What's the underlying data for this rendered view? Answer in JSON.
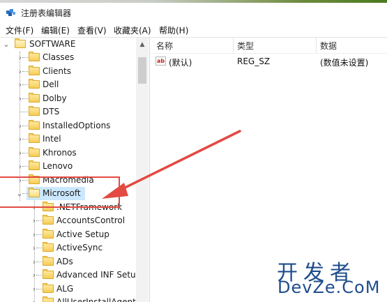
{
  "window": {
    "title": "注册表编辑器",
    "icon": "regedit-icon"
  },
  "menu": [
    "文件(F)",
    "编辑(E)",
    "查看(V)",
    "收藏夹(A)",
    "帮助(H)"
  ],
  "tree": {
    "root": "SOFTWARE",
    "items": [
      "Classes",
      "Clients",
      "Dell",
      "Dolby",
      "DTS",
      "InstalledOptions",
      "Intel",
      "Khronos",
      "Lenovo",
      "Macromedia",
      "Microsoft"
    ],
    "selected": "Microsoft",
    "children": [
      ".NETFramework",
      "AccountsControl",
      "Active Setup",
      "ActiveSync",
      "ADs",
      "Advanced INF Setup",
      "ALG",
      "AllUserInstallAgent"
    ]
  },
  "list": {
    "columns": [
      "名称",
      "类型",
      "数据"
    ],
    "rows": [
      {
        "name": "(默认)",
        "type": "REG_SZ",
        "data": "(数值未设置)"
      }
    ]
  },
  "annotation": {
    "color": "#e34a43"
  },
  "watermark": {
    "cn": "开发者",
    "en": "DevZe.CoM"
  }
}
